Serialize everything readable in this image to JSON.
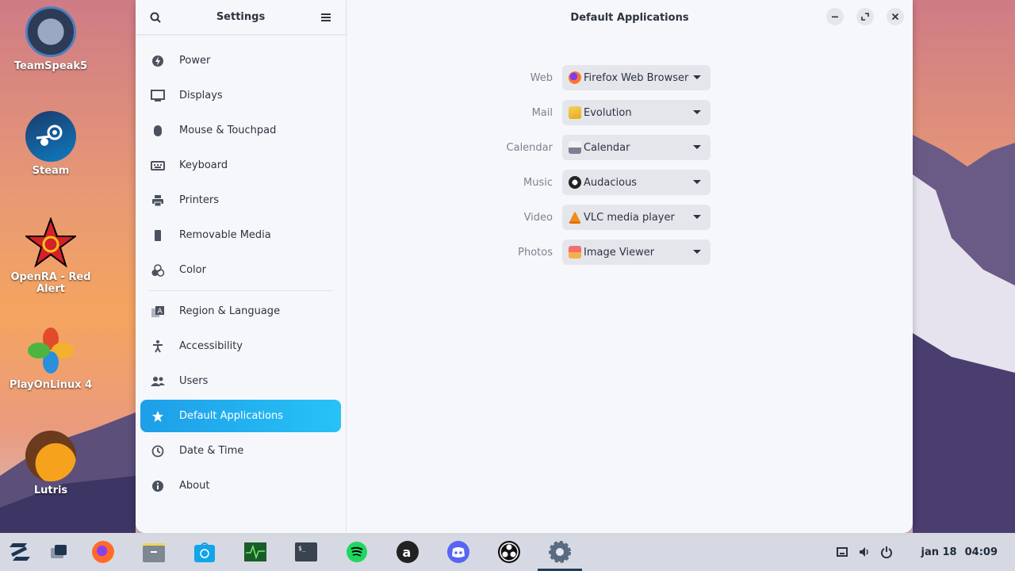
{
  "desktop": {
    "icons": [
      {
        "label": "TeamSpeak5",
        "icon": "teamspeak-icon"
      },
      {
        "label": "Steam",
        "icon": "steam-icon"
      },
      {
        "label": "OpenRA - Red Alert",
        "icon": "openra-icon"
      },
      {
        "label": "PlayOnLinux 4",
        "icon": "playonlinux-icon"
      },
      {
        "label": "Lutris",
        "icon": "lutris-icon"
      }
    ]
  },
  "settings": {
    "sidebar_title": "Settings",
    "page_title": "Default Applications",
    "nav": [
      {
        "label": "Power",
        "icon": "power-icon"
      },
      {
        "label": "Displays",
        "icon": "display-icon"
      },
      {
        "label": "Mouse & Touchpad",
        "icon": "mouse-icon"
      },
      {
        "label": "Keyboard",
        "icon": "keyboard-icon"
      },
      {
        "label": "Printers",
        "icon": "printer-icon"
      },
      {
        "label": "Removable Media",
        "icon": "usb-icon"
      },
      {
        "label": "Color",
        "icon": "color-icon"
      },
      {
        "label": "Region & Language",
        "icon": "language-icon"
      },
      {
        "label": "Accessibility",
        "icon": "accessibility-icon"
      },
      {
        "label": "Users",
        "icon": "users-icon"
      },
      {
        "label": "Default Applications",
        "icon": "star-icon",
        "active": true
      },
      {
        "label": "Date & Time",
        "icon": "clock-icon"
      },
      {
        "label": "About",
        "icon": "info-icon"
      }
    ],
    "defaults": [
      {
        "label": "Web",
        "value": "Firefox Web Browser",
        "icon": "firefox-icon"
      },
      {
        "label": "Mail",
        "value": "Evolution",
        "icon": "mail-icon"
      },
      {
        "label": "Calendar",
        "value": "Calendar",
        "icon": "calendar-icon"
      },
      {
        "label": "Music",
        "value": "Audacious",
        "icon": "audacious-icon"
      },
      {
        "label": "Video",
        "value": "VLC media player",
        "icon": "vlc-icon"
      },
      {
        "label": "Photos",
        "value": "Image Viewer",
        "icon": "image-viewer-icon"
      }
    ]
  },
  "taskbar": {
    "apps": [
      "zorin-menu-icon",
      "workspaces-icon",
      "firefox-icon",
      "files-icon",
      "software-store-icon",
      "system-monitor-icon",
      "terminal-icon",
      "spotify-icon",
      "audacious-icon",
      "discord-icon",
      "obs-icon",
      "settings-icon"
    ],
    "tray": [
      "network-icon",
      "volume-icon",
      "power-icon"
    ],
    "date": "jan 18",
    "time": "04:09"
  },
  "colors": {
    "accent": "#1e9ee8",
    "window_bg": "#f6f7fa"
  }
}
